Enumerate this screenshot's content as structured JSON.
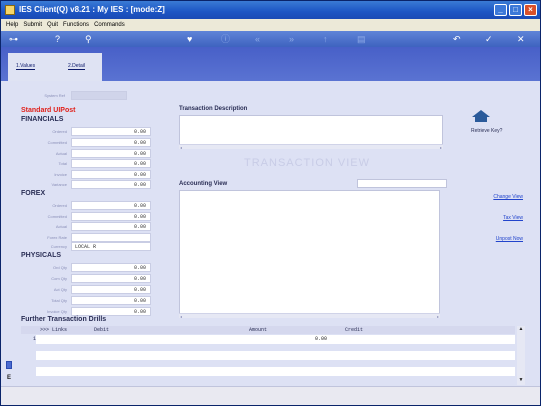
{
  "window": {
    "title": "IES Client(Q) v8.21 : My IES :        [mode:Z]"
  },
  "menu": [
    "Help",
    "Submit",
    "Quit",
    "Functions",
    "Commands"
  ],
  "toolbar": {
    "icons": [
      "key-icon",
      "help-icon",
      "search-icon",
      "heart-icon",
      "info-icon",
      "rewind-icon",
      "forward-icon",
      "up-icon",
      "doc-icon",
      "back-icon",
      "check-icon",
      "close-icon"
    ]
  },
  "tabs": [
    {
      "label": "1.Values"
    },
    {
      "label": "2.Detail"
    }
  ],
  "form": {
    "system_ref_label": "System Ref",
    "mode_title": "Standard UIPost",
    "financials": {
      "title": "FINANCIALS",
      "rows": [
        {
          "label": "Ordered",
          "value": "0.00"
        },
        {
          "label": "Committed",
          "value": "0.00"
        },
        {
          "label": "Actual",
          "value": "0.00"
        },
        {
          "label": "Total",
          "value": "0.00"
        },
        {
          "label": "Invoice",
          "value": "0.00"
        },
        {
          "label": "Variance",
          "value": "0.00"
        }
      ]
    },
    "forex": {
      "title": "FOREX",
      "rows": [
        {
          "label": "Ordered",
          "value": "0.00"
        },
        {
          "label": "Committed",
          "value": "0.00"
        },
        {
          "label": "Actual",
          "value": "0.00"
        },
        {
          "label": "Forex Rate",
          "value": ""
        },
        {
          "label": "Currency",
          "value": "LOCAL R"
        }
      ]
    },
    "physicals": {
      "title": "PHYSICALS",
      "rows": [
        {
          "label": "Ord Qty",
          "value": "0.00"
        },
        {
          "label": "Com Qty",
          "value": "0.00"
        },
        {
          "label": "Act Qty",
          "value": "0.00"
        },
        {
          "label": "Total Qty",
          "value": "0.00"
        },
        {
          "label": "Invoice Qty",
          "value": "0.00"
        }
      ]
    }
  },
  "transaction": {
    "description_title": "Transaction Description",
    "watermark": "TRANSACTION VIEW",
    "accounting_title": "Accounting View"
  },
  "sidebar": {
    "retrieve_label": "Retrieve Key?",
    "links": [
      "Change View",
      "Tax View",
      "Unpost Now"
    ]
  },
  "drills": {
    "title": "Further Transaction Drills",
    "columns": [
      ">>> Links",
      "Debit",
      "Amount",
      "Credit"
    ],
    "rows": [
      {
        "index": "1",
        "amount": "0.00"
      }
    ]
  }
}
